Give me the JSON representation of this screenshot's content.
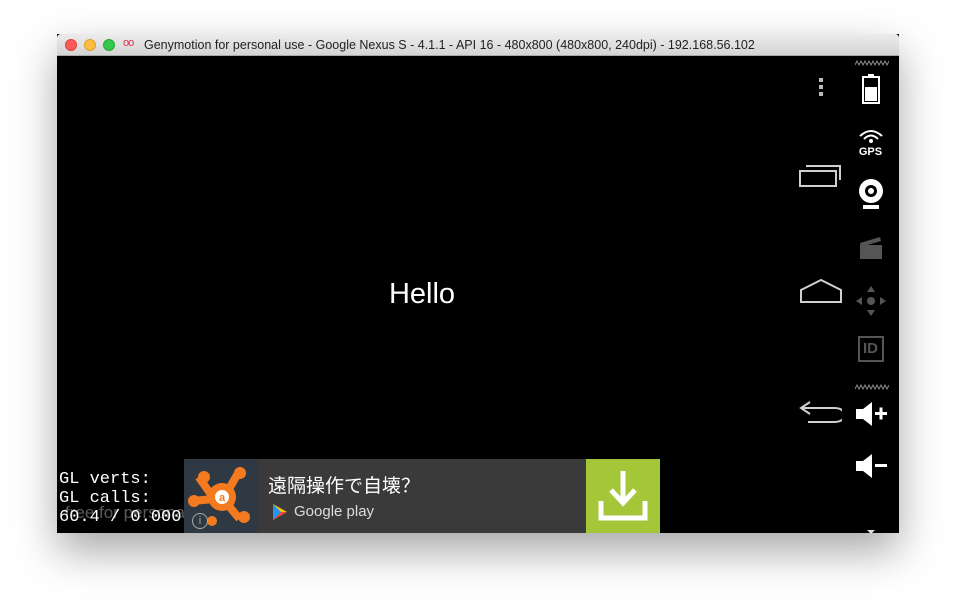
{
  "window": {
    "title": "Genymotion for personal use - Google Nexus S - 4.1.1 - API 16 - 480x800 (480x800, 240dpi) - 192.168.56.102",
    "logo": "oo"
  },
  "screen": {
    "hello": "Hello",
    "gl_verts": "GL verts:",
    "gl_calls": "GL calls:",
    "fps": "60.4 / 0.000",
    "watermark": "free for personal use"
  },
  "ad": {
    "headline": "遠隔操作で自壊？",
    "store": "Google play",
    "info": "i",
    "colors": {
      "download_bg": "#a4c639",
      "icon_orange": "#f47a20"
    }
  },
  "navbar": {
    "icons": [
      "menu-icon",
      "recent-apps-icon",
      "home-icon",
      "back-icon"
    ]
  },
  "sidebar": {
    "gps_label": "GPS",
    "id_label": "ID",
    "icons": [
      "battery-icon",
      "gps-icon",
      "camera-icon",
      "capture-icon",
      "dpad-icon",
      "id-icon",
      "volume-up-icon",
      "volume-down-icon"
    ]
  }
}
